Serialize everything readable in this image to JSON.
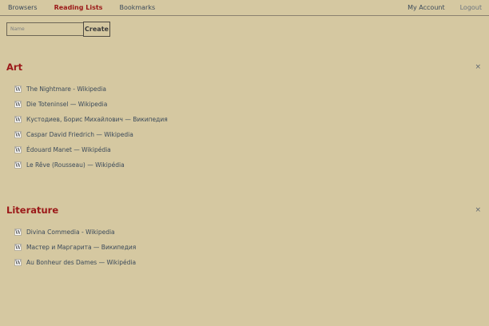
{
  "nav": {
    "left": [
      "Browsers",
      "Reading Lists",
      "Bookmarks"
    ],
    "active": "Reading Lists",
    "account": "My Account",
    "logout": "Logout"
  },
  "form": {
    "name_placeholder": "Name",
    "name_value": "",
    "create_label": "Create"
  },
  "lists": [
    {
      "title": "Art",
      "close_label": "×",
      "items": [
        {
          "icon": "wikipedia-icon",
          "label": "The Nightmare - Wikipedia"
        },
        {
          "icon": "wikipedia-icon",
          "label": "Die Toteninsel — Wikipedia"
        },
        {
          "icon": "wikipedia-icon",
          "label": "Кустодиев, Борис Михайлович — Википедия"
        },
        {
          "icon": "wikipedia-icon",
          "label": "Caspar David Friedrich — Wikipedia"
        },
        {
          "icon": "wikipedia-icon",
          "label": "Édouard Manet — Wikipédia"
        },
        {
          "icon": "wikipedia-icon",
          "label": "Le Rêve (Rousseau) — Wikipédia"
        }
      ]
    },
    {
      "title": "Literature",
      "close_label": "×",
      "items": [
        {
          "icon": "wikipedia-icon",
          "label": "Divina Commedia - Wikipedia"
        },
        {
          "icon": "wikipedia-icon",
          "label": "Мастер и Маргарита — Википедия"
        },
        {
          "icon": "wikipedia-icon",
          "label": "Au Bonheur des Dames — Wikipédia"
        }
      ]
    }
  ],
  "icon_glyph": "W",
  "colors": {
    "background": "#d5c8a1",
    "accent": "#9b1818",
    "text": "#3b4a5a"
  }
}
